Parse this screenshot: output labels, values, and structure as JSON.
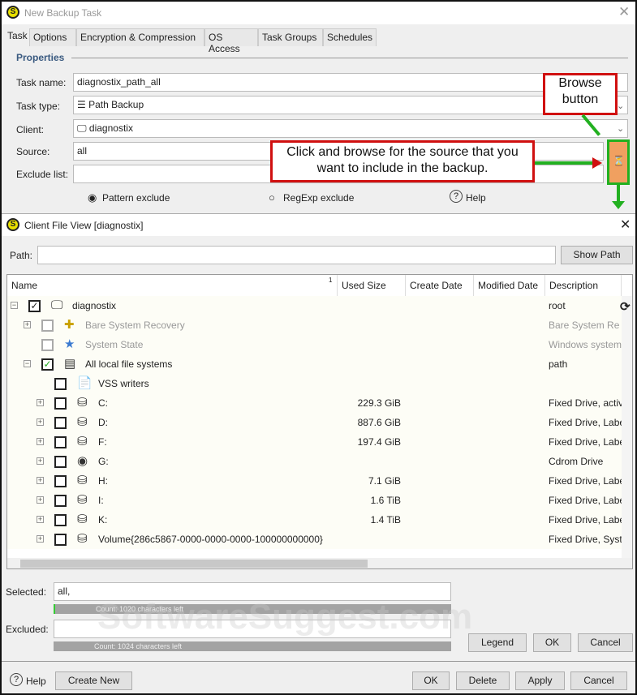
{
  "window": {
    "title": "New Backup Task"
  },
  "tabs": [
    "Task",
    "Options",
    "Encryption & Compression",
    "OS Access",
    "Task Groups",
    "Schedules"
  ],
  "properties": {
    "heading": "Properties",
    "task_name_label": "Task name:",
    "task_name": "diagnostix_path_all",
    "task_type_label": "Task type:",
    "task_type": "Path Backup",
    "client_label": "Client:",
    "client": "diagnostix",
    "source_label": "Source:",
    "source": "all",
    "exclude_label": "Exclude list:",
    "exclude": "",
    "pattern_exclude": "Pattern exclude",
    "regexp_exclude": "RegExp exclude",
    "help": "Help"
  },
  "annotations": {
    "browse": "Browse button",
    "click": "Click and browse for the source that you want to include in the backup."
  },
  "accent": {
    "annotation_red": "#d01010",
    "annotation_green": "#22b020",
    "browse_button": "#f0a060"
  },
  "client_view": {
    "title": "Client File View [diagnostix]",
    "path_label": "Path:",
    "path": "",
    "show_path": "Show Path",
    "columns": [
      "Name",
      "Used Size",
      "Create Date",
      "Modified Date",
      "Description"
    ],
    "sort_indicator": "1",
    "rows": [
      {
        "name": "diagnostix",
        "level": 0,
        "expander": "-",
        "checked": true,
        "icon": "computer-icon",
        "size": "",
        "desc": "root"
      },
      {
        "name": "Bare System Recovery",
        "level": 1,
        "expander": "+",
        "checked": false,
        "disabled": true,
        "icon": "bare-recovery-icon",
        "size": "",
        "desc": "Bare System Re"
      },
      {
        "name": "System State",
        "level": 1,
        "expander": "",
        "checked": false,
        "disabled": true,
        "icon": "star-icon",
        "size": "",
        "desc": "Windows system"
      },
      {
        "name": "All local file systems",
        "level": 1,
        "expander": "-",
        "checked": true,
        "green": true,
        "icon": "server-icon",
        "size": "",
        "desc": "path"
      },
      {
        "name": "VSS writers",
        "level": 2,
        "expander": "",
        "checked": false,
        "icon": "vss-icon",
        "size": "",
        "desc": ""
      },
      {
        "name": "C:",
        "level": 2,
        "expander": "+",
        "checked": false,
        "icon": "drive-icon",
        "size": "229.3 GiB",
        "desc": "Fixed Drive, active"
      },
      {
        "name": "D:",
        "level": 2,
        "expander": "+",
        "checked": false,
        "icon": "drive-icon",
        "size": "887.6 GiB",
        "desc": "Fixed Drive, Label"
      },
      {
        "name": "F:",
        "level": 2,
        "expander": "+",
        "checked": false,
        "icon": "drive-icon",
        "size": "197.4 GiB",
        "desc": "Fixed Drive, Label"
      },
      {
        "name": "G:",
        "level": 2,
        "expander": "+",
        "checked": false,
        "icon": "cdrom-icon",
        "size": "",
        "desc": "Cdrom Drive"
      },
      {
        "name": "H:",
        "level": 2,
        "expander": "+",
        "checked": false,
        "icon": "drive-icon",
        "size": "7.1 GiB",
        "desc": "Fixed Drive, Label"
      },
      {
        "name": "I:",
        "level": 2,
        "expander": "+",
        "checked": false,
        "icon": "drive-icon",
        "size": "1.6 TiB",
        "desc": "Fixed Drive, Label"
      },
      {
        "name": "K:",
        "level": 2,
        "expander": "+",
        "checked": false,
        "icon": "drive-icon",
        "size": "1.4 TiB",
        "desc": "Fixed Drive, Label"
      },
      {
        "name": "Volume{286c5867-0000-0000-0000-100000000000}",
        "level": 2,
        "expander": "+",
        "checked": false,
        "icon": "drive-icon",
        "size": "",
        "desc": "Fixed Drive, System"
      }
    ],
    "selected_label": "Selected:",
    "selected": "all,",
    "selected_count": "Count: 1020 characters left",
    "excluded_label": "Excluded:",
    "excluded": "",
    "excluded_count": "Count: 1024 characters left",
    "legend": "Legend",
    "ok": "OK",
    "cancel": "Cancel"
  },
  "footer": {
    "help": "Help",
    "create_new": "Create New",
    "ok": "OK",
    "delete": "Delete",
    "apply": "Apply",
    "cancel": "Cancel"
  },
  "watermark": "SoftwareSuggest.com"
}
